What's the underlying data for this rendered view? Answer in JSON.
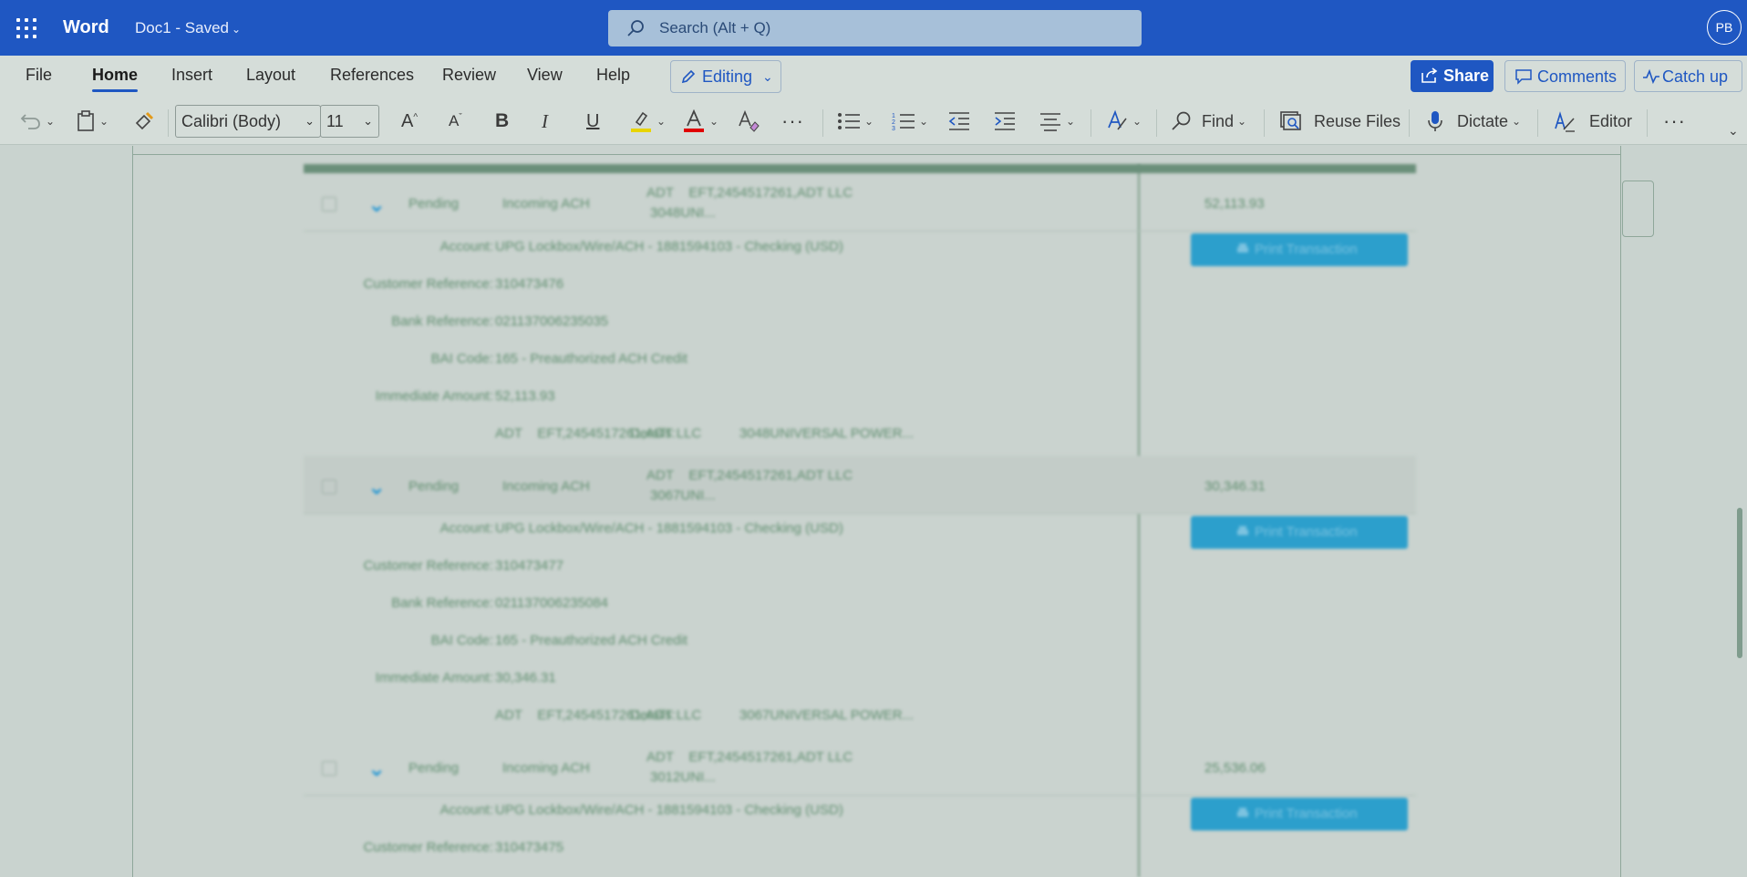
{
  "titlebar": {
    "app_name": "Word",
    "doc_name": "Doc1 - Saved",
    "search_placeholder": "Search (Alt + Q)",
    "avatar_initials": "PB"
  },
  "menu": {
    "items": [
      "File",
      "Home",
      "Insert",
      "Layout",
      "References",
      "Review",
      "View",
      "Help"
    ],
    "active": "Home",
    "editing_label": "Editing",
    "share_label": "Share",
    "comments_label": "Comments",
    "catchup_label": "Catch up"
  },
  "ribbon": {
    "font_name": "Calibri (Body)",
    "font_size": "11",
    "find_label": "Find",
    "reuse_files_label": "Reuse Files",
    "dictate_label": "Dictate",
    "editor_label": "Editor",
    "highlight_color": "#e8d400",
    "font_color": "#e00000"
  },
  "transactions": [
    {
      "status": "Pending",
      "type": "Incoming ACH",
      "desc_line1": "ADT    EFT,2454517261,ADT LLC",
      "desc_line2": "3048UNI...",
      "amount": "52,113.93",
      "print_label": "Print Transaction",
      "details": {
        "account": "UPG Lockbox/Wire/ACH - 1881594103 - Checking (USD)",
        "customer_reference": "310473476",
        "bank_reference": "021137006235035",
        "bai_code": "165 - Preauthorized ACH Credit",
        "immediate_amount": "52,113.93",
        "details": "ADT    EFT,2454517261,ADT LLC          3048UNIVERSAL POWER..."
      }
    },
    {
      "status": "Pending",
      "type": "Incoming ACH",
      "desc_line1": "ADT    EFT,2454517261,ADT LLC",
      "desc_line2": "3067UNI...",
      "amount": "30,346.31",
      "print_label": "Print Transaction",
      "details": {
        "account": "UPG Lockbox/Wire/ACH - 1881594103 - Checking (USD)",
        "customer_reference": "310473477",
        "bank_reference": "021137006235084",
        "bai_code": "165 - Preauthorized ACH Credit",
        "immediate_amount": "30,346.31",
        "details": "ADT    EFT,2454517261,ADT LLC          3067UNIVERSAL POWER..."
      }
    },
    {
      "status": "Pending",
      "type": "Incoming ACH",
      "desc_line1": "ADT    EFT,2454517261,ADT LLC",
      "desc_line2": "3012UNI...",
      "amount": "25,536.06",
      "print_label": "Print Transaction",
      "details": {
        "account": "UPG Lockbox/Wire/ACH - 1881594103 - Checking (USD)",
        "customer_reference": "310473475"
      }
    }
  ],
  "detail_labels": {
    "account": "Account:",
    "customer_reference": "Customer Reference:",
    "bank_reference": "Bank Reference:",
    "bai_code": "BAI Code:",
    "immediate_amount": "Immediate Amount:",
    "details": "Details:"
  }
}
